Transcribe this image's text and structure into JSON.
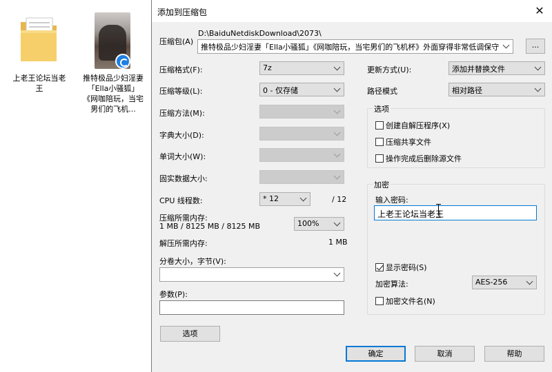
{
  "desktop": {
    "folder": {
      "label": "上老王论坛当老王",
      "icon": "folder-icon"
    },
    "video": {
      "label": "推特极品少妇淫妻「Ella小骚狐」《网咖陪玩，当宅男们的飞机...",
      "icon": "video-file-icon"
    }
  },
  "dialog": {
    "title": "添加到压缩包",
    "close_label": "✕",
    "archive_label": "压缩包(A)",
    "archive_path": "D:\\BaiduNetdiskDownload\\2073\\",
    "archive_name": "推特极品少妇淫妻「Ella小骚狐」《网咖陪玩，当宅男们的飞机杯》外面穿得非常低调保守",
    "browse_label": "...",
    "format_label": "压缩格式(F):",
    "format_value": "7z",
    "level_label": "压缩等级(L):",
    "level_value": "0 - 仅存储",
    "method_label": "压缩方法(M):",
    "dict_label": "字典大小(D):",
    "word_label": "单词大小(W):",
    "solid_label": "固实数据大小:",
    "cpu_label": "CPU 线程数:",
    "cpu_value": "* 12",
    "cpu_total": "/ 12",
    "mem_comp_label": "压缩所需内存:",
    "mem_comp_value": "1 MB / 8125 MB / 8125 MB",
    "mem_percent": "100%",
    "mem_decomp_label": "解压所需内存:",
    "mem_decomp_value": "1 MB",
    "volume_label": "分卷大小，字节(V):",
    "volume_value": "",
    "params_label": "参数(P):",
    "params_value": "",
    "options_button": "选项",
    "update_label": "更新方式(U):",
    "update_value": "添加并替换文件",
    "path_label": "路径模式",
    "path_value": "相对路径",
    "options_group": "选项",
    "opt_sfx": "创建自解压程序(X)",
    "opt_shared": "压缩共享文件",
    "opt_delete": "操作完成后删除源文件",
    "encrypt_group": "加密",
    "password_label": "输入密码:",
    "password_value": "上老王论坛当老王",
    "show_password": "显示密码(S)",
    "enc_method_label": "加密算法:",
    "enc_method_value": "AES-256",
    "encrypt_names": "加密文件名(N)",
    "ok_button": "确定",
    "cancel_button": "取消",
    "help_button": "帮助"
  }
}
